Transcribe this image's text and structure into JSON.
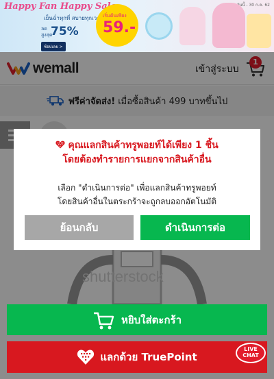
{
  "banner": {
    "title": "Happy Fan Happy Sale",
    "subtitle": "เย็นฉ่ำทุกที่ สบายทุกเวลา",
    "discount_prefix": "ลด\nสูงสุด",
    "discount": "75%",
    "button": "ช้อปเลย >",
    "price_prefix": "เริ่มต้นเพียง",
    "price": "59.-",
    "topnote": "วันนี้ - 30 ก.ค. 62"
  },
  "header": {
    "logo_text": "wemall",
    "login": "เข้าสู่ระบบ",
    "cart_count": "1"
  },
  "shipping": {
    "bold": "ฟรีค่าจัดส่ง!",
    "text": "เมื่อซื้อสินค้า 499 บาทขึ้นไป"
  },
  "watermark": "shutterstock",
  "dialog": {
    "title_line1": "คุณแลกสินค้าทรูพอยท์ได้เพียง 1 ชิ้น",
    "title_line2": "โดยต้องทำรายการแยกจากสินค้าอื่น",
    "message_line1": "เลือก \"ดำเนินการต่อ\" เพื่อแลกสินค้าทรูพอยท์",
    "message_line2": "โดยสินค้าอื่นในตระกร้าจะถูกลบออกอัตโนมัติ",
    "back_label": "ย้อนกลับ",
    "continue_label": "ดำเนินการต่อ"
  },
  "bottom": {
    "add_to_cart": "หยิบใส่ตะกร้า",
    "truepoint": "แลกด้วย TruePoint",
    "live_line1": "LIVE",
    "live_line2": "CHAT"
  },
  "colors": {
    "green": "#07b74f",
    "red": "#d8181f",
    "gray_button": "#a7a7a7"
  }
}
